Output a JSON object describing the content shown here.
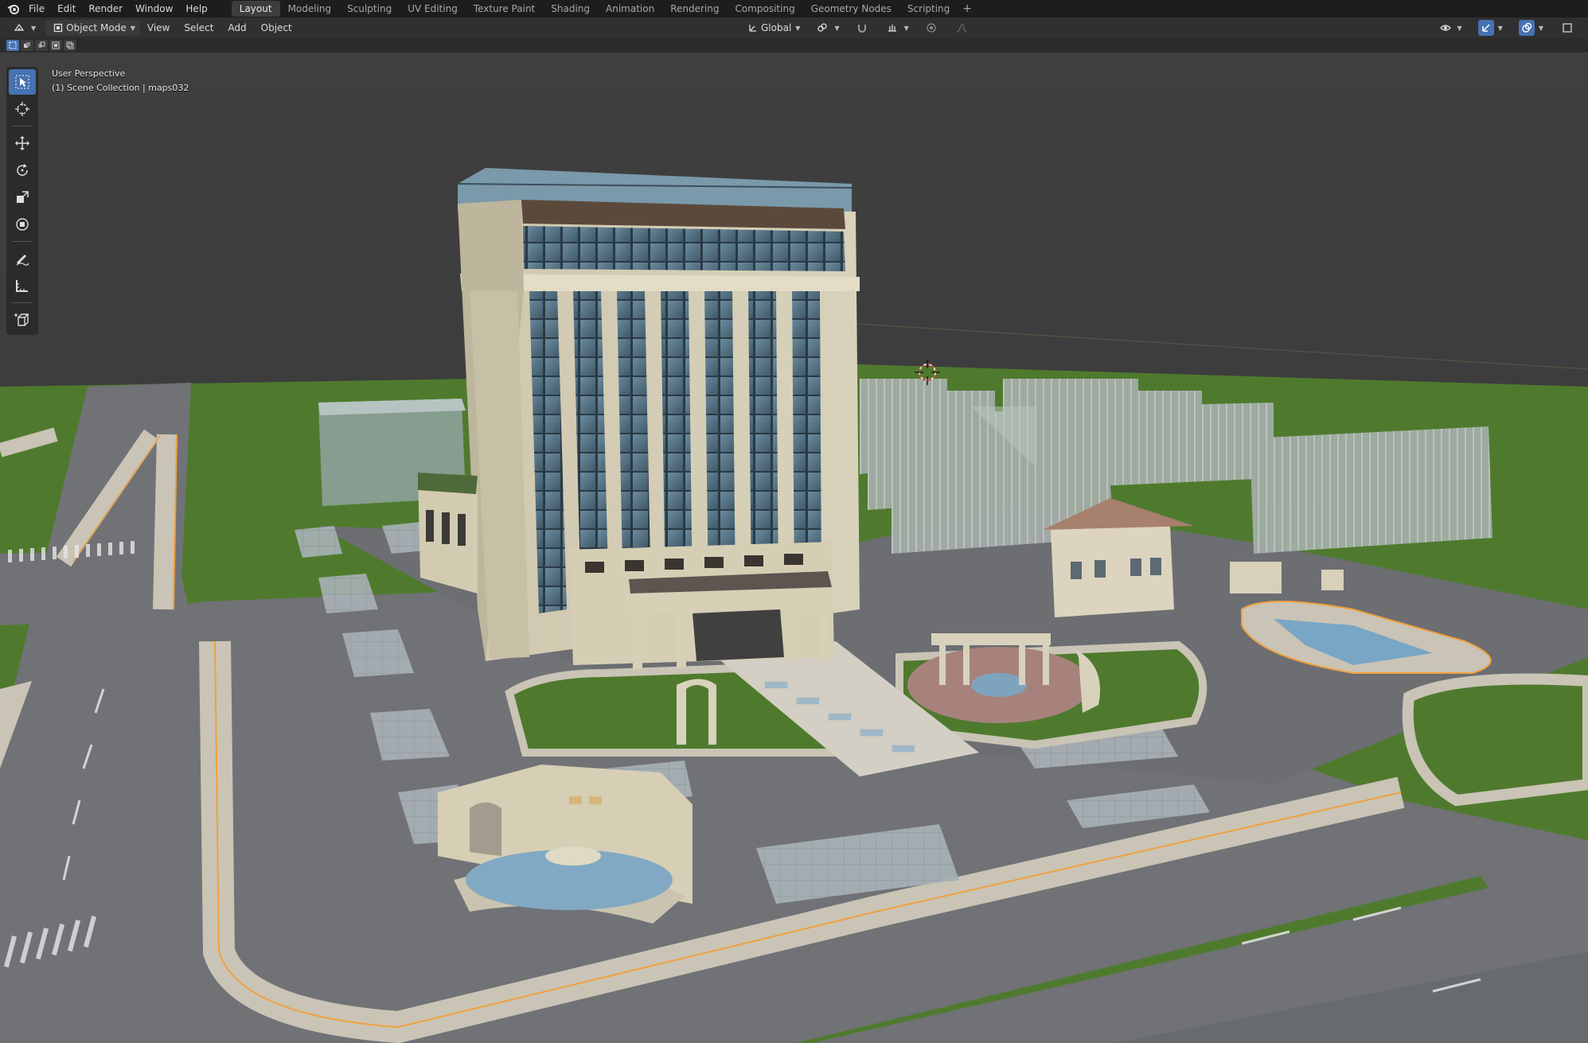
{
  "topbar": {
    "menus": [
      "File",
      "Edit",
      "Render",
      "Window",
      "Help"
    ],
    "workspaces": [
      "Layout",
      "Modeling",
      "Sculpting",
      "UV Editing",
      "Texture Paint",
      "Shading",
      "Animation",
      "Rendering",
      "Compositing",
      "Geometry Nodes",
      "Scripting"
    ],
    "active_workspace": "Layout",
    "add_workspace": "+"
  },
  "header": {
    "mode": "Object Mode",
    "menus": [
      "View",
      "Select",
      "Add",
      "Object"
    ],
    "transform_orientation": "Global"
  },
  "viewport": {
    "perspective_label": "User Perspective",
    "collection_label": "(1) Scene Collection | maps032"
  },
  "toolbar": {
    "tools": [
      "select-box",
      "cursor",
      "move",
      "rotate",
      "scale",
      "transform",
      "annotate",
      "measure",
      "add-cube"
    ],
    "active_tool": "select-box"
  },
  "colors": {
    "accent": "#4772b3",
    "topbar_bg": "#1d1d1d",
    "header_bg": "#303030",
    "viewport_bg": "#3d3d3d",
    "grass": "#4a7a2a",
    "road": "#6f6f72",
    "selection_outline": "#f0a040"
  }
}
